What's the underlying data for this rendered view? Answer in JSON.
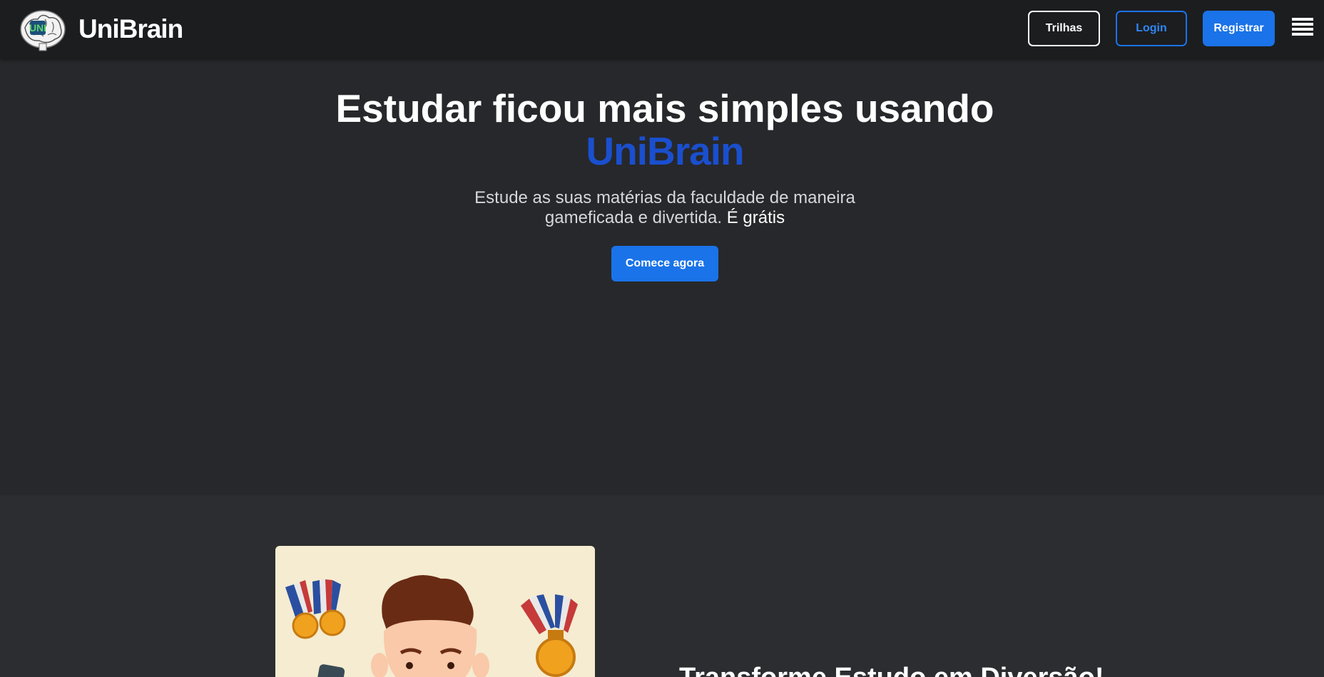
{
  "navbar": {
    "brand": "UniBrain",
    "logo_icon": "brain-logo-icon",
    "buttons": {
      "trilhas": "Trilhas",
      "login": "Login",
      "registrar": "Registrar"
    },
    "menu_icon": "hamburger-menu-icon"
  },
  "hero": {
    "title": "Estudar ficou mais simples usando",
    "brand": "UniBrain",
    "subtitle_line1": "Estude as suas matérias da faculdade de maneira",
    "subtitle_line2": "gameficada e divertida.",
    "subtitle_free": "É grátis",
    "cta": "Comece agora"
  },
  "section2": {
    "illustration": "student-medals-illustration",
    "title": "Transforme Estudo em Diversão!"
  },
  "colors": {
    "navbar_bg": "#1c1d1f",
    "page_bg": "#27282b",
    "section_bg": "#2c2d30",
    "accent": "#1a73e8",
    "brand_blue": "#1a4fce"
  }
}
